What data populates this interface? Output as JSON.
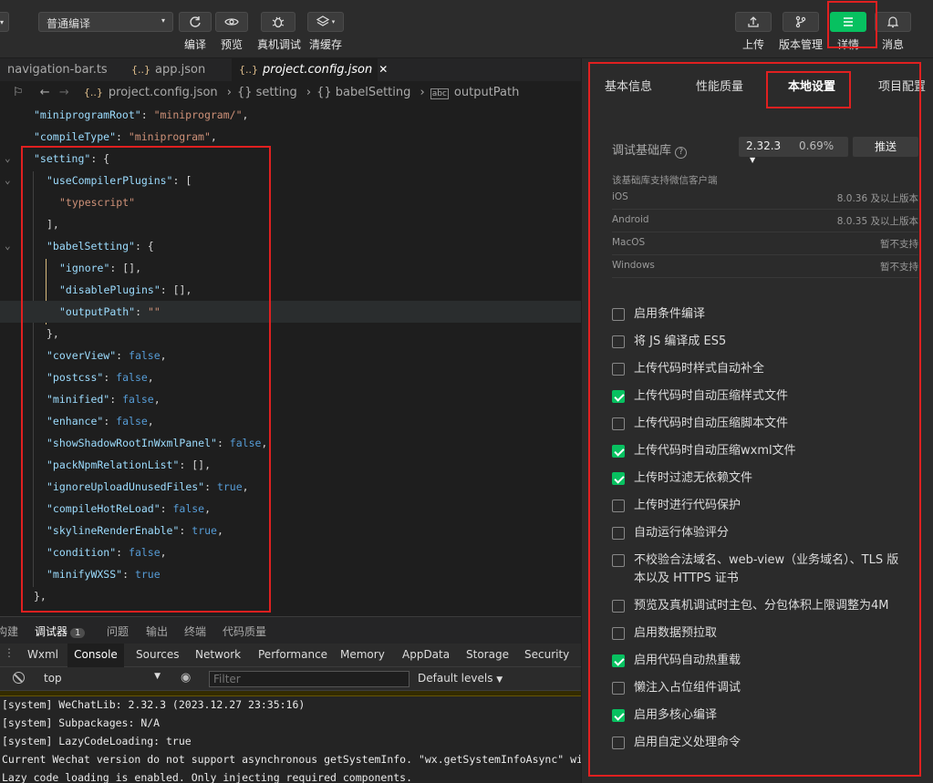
{
  "toolbar": {
    "compile_mode": "普通编译",
    "buttons": {
      "compile": "编译",
      "preview": "预览",
      "remote_debug": "真机调试",
      "clear_cache": "清缓存",
      "upload": "上传",
      "version": "版本管理",
      "details": "详情",
      "messages": "消息"
    },
    "accent": "#07c160"
  },
  "editor": {
    "tabs": [
      {
        "label": "navigation-bar.ts"
      },
      {
        "label": "app.json"
      },
      {
        "label": "project.config.json",
        "active": true
      }
    ],
    "tab_close": "✕",
    "breadcrumb": [
      "project.config.json",
      "{} setting",
      "{} babelSetting",
      "outputPath"
    ],
    "lines": [
      {
        "ind": 0,
        "parts": [
          [
            "k",
            "\"miniprogramRoot\""
          ],
          [
            "p",
            ": "
          ],
          [
            "s",
            "\"miniprogram/\""
          ],
          [
            "p",
            ","
          ]
        ]
      },
      {
        "ind": 0,
        "parts": [
          [
            "k",
            "\"compileType\""
          ],
          [
            "p",
            ": "
          ],
          [
            "s",
            "\"miniprogram\""
          ],
          [
            "p",
            ","
          ]
        ]
      },
      {
        "ind": 0,
        "parts": [
          [
            "k",
            "\"setting\""
          ],
          [
            "p",
            ": {"
          ]
        ],
        "fold": true
      },
      {
        "ind": 1,
        "parts": [
          [
            "k",
            "\"useCompilerPlugins\""
          ],
          [
            "p",
            ": ["
          ]
        ],
        "fold": true
      },
      {
        "ind": 2,
        "parts": [
          [
            "s",
            "\"typescript\""
          ]
        ]
      },
      {
        "ind": 1,
        "parts": [
          [
            "p",
            "],"
          ]
        ]
      },
      {
        "ind": 1,
        "parts": [
          [
            "k",
            "\"babelSetting\""
          ],
          [
            "p",
            ": {"
          ]
        ],
        "fold": true
      },
      {
        "ind": 2,
        "parts": [
          [
            "k",
            "\"ignore\""
          ],
          [
            "p",
            ": [],"
          ]
        ]
      },
      {
        "ind": 2,
        "parts": [
          [
            "k",
            "\"disablePlugins\""
          ],
          [
            "p",
            ": [],"
          ]
        ]
      },
      {
        "ind": 2,
        "parts": [
          [
            "k",
            "\"outputPath\""
          ],
          [
            "p",
            ": "
          ],
          [
            "s",
            "\"\""
          ]
        ],
        "hl": true
      },
      {
        "ind": 1,
        "parts": [
          [
            "p",
            "},"
          ]
        ]
      },
      {
        "ind": 1,
        "parts": [
          [
            "k",
            "\"coverView\""
          ],
          [
            "p",
            ": "
          ],
          [
            "kw",
            "false"
          ],
          [
            "p",
            ","
          ]
        ]
      },
      {
        "ind": 1,
        "parts": [
          [
            "k",
            "\"postcss\""
          ],
          [
            "p",
            ": "
          ],
          [
            "kw",
            "false"
          ],
          [
            "p",
            ","
          ]
        ]
      },
      {
        "ind": 1,
        "parts": [
          [
            "k",
            "\"minified\""
          ],
          [
            "p",
            ": "
          ],
          [
            "kw",
            "false"
          ],
          [
            "p",
            ","
          ]
        ]
      },
      {
        "ind": 1,
        "parts": [
          [
            "k",
            "\"enhance\""
          ],
          [
            "p",
            ": "
          ],
          [
            "kw",
            "false"
          ],
          [
            "p",
            ","
          ]
        ]
      },
      {
        "ind": 1,
        "parts": [
          [
            "k",
            "\"showShadowRootInWxmlPanel\""
          ],
          [
            "p",
            ": "
          ],
          [
            "kw",
            "false"
          ],
          [
            "p",
            ","
          ]
        ]
      },
      {
        "ind": 1,
        "parts": [
          [
            "k",
            "\"packNpmRelationList\""
          ],
          [
            "p",
            ": [],"
          ]
        ]
      },
      {
        "ind": 1,
        "parts": [
          [
            "k",
            "\"ignoreUploadUnusedFiles\""
          ],
          [
            "p",
            ": "
          ],
          [
            "kw",
            "true"
          ],
          [
            "p",
            ","
          ]
        ]
      },
      {
        "ind": 1,
        "parts": [
          [
            "k",
            "\"compileHotReLoad\""
          ],
          [
            "p",
            ": "
          ],
          [
            "kw",
            "false"
          ],
          [
            "p",
            ","
          ]
        ]
      },
      {
        "ind": 1,
        "parts": [
          [
            "k",
            "\"skylineRenderEnable\""
          ],
          [
            "p",
            ": "
          ],
          [
            "kw",
            "true"
          ],
          [
            "p",
            ","
          ]
        ]
      },
      {
        "ind": 1,
        "parts": [
          [
            "k",
            "\"condition\""
          ],
          [
            "p",
            ": "
          ],
          [
            "kw",
            "false"
          ],
          [
            "p",
            ","
          ]
        ]
      },
      {
        "ind": 1,
        "parts": [
          [
            "k",
            "\"minifyWXSS\""
          ],
          [
            "p",
            ": "
          ],
          [
            "kw",
            "true"
          ]
        ]
      },
      {
        "ind": 0,
        "parts": [
          [
            "p",
            "},"
          ]
        ]
      }
    ]
  },
  "panel": {
    "tabs": [
      "构建",
      "调试器",
      "问题",
      "输出",
      "终端",
      "代码质量"
    ],
    "debugger_badge": "1",
    "devtools_tabs": [
      "Wxml",
      "Console",
      "Sources",
      "Network",
      "Performance",
      "Memory",
      "AppData",
      "Storage",
      "Security"
    ],
    "context": "top",
    "filter_placeholder": "Filter",
    "levels": "Default levels",
    "console_lines": [
      "[system] WeChatLib: 2.32.3 (2023.12.27 23:35:16)",
      "[system] Subpackages: N/A",
      "[system] LazyCodeLoading: true",
      "Current Wechat version do not support asynchronous getSystemInfo. \"wx.getSystemInfoAsync\" will be",
      "Lazy code loading is enabled. Only injecting required components."
    ]
  },
  "details": {
    "tabs": [
      "基本信息",
      "性能质量",
      "本地设置",
      "项目配置"
    ],
    "base_lib_label": "调试基础库",
    "base_lib_version": "2.32.3",
    "base_lib_share": "0.69%",
    "push_button": "推送",
    "support_title": "该基础库支持微信客户端",
    "support": [
      {
        "os": "iOS",
        "v": "8.0.36 及以上版本"
      },
      {
        "os": "Android",
        "v": "8.0.35 及以上版本"
      },
      {
        "os": "MacOS",
        "v": "暂不支持"
      },
      {
        "os": "Windows",
        "v": "暂不支持"
      }
    ],
    "options": [
      {
        "label": "启用条件编译",
        "checked": false
      },
      {
        "label": "将 JS 编译成 ES5",
        "checked": false
      },
      {
        "label": "上传代码时样式自动补全",
        "checked": false
      },
      {
        "label": "上传代码时自动压缩样式文件",
        "checked": true
      },
      {
        "label": "上传代码时自动压缩脚本文件",
        "checked": false
      },
      {
        "label": "上传代码时自动压缩wxml文件",
        "checked": true
      },
      {
        "label": "上传时过滤无依赖文件",
        "checked": true
      },
      {
        "label": "上传时进行代码保护",
        "checked": false
      },
      {
        "label": "自动运行体验评分",
        "checked": false
      },
      {
        "label": "不校验合法域名、web-view（业务域名）、TLS 版本以及 HTTPS 证书",
        "checked": false
      },
      {
        "label": "预览及真机调试时主包、分包体积上限调整为4M",
        "checked": false
      },
      {
        "label": "启用数据预拉取",
        "checked": false
      },
      {
        "label": "启用代码自动热重载",
        "checked": true
      },
      {
        "label": "懒注入占位组件调试",
        "checked": false
      },
      {
        "label": "启用多核心编译",
        "checked": true
      },
      {
        "label": "启用自定义处理命令",
        "checked": false
      }
    ]
  }
}
